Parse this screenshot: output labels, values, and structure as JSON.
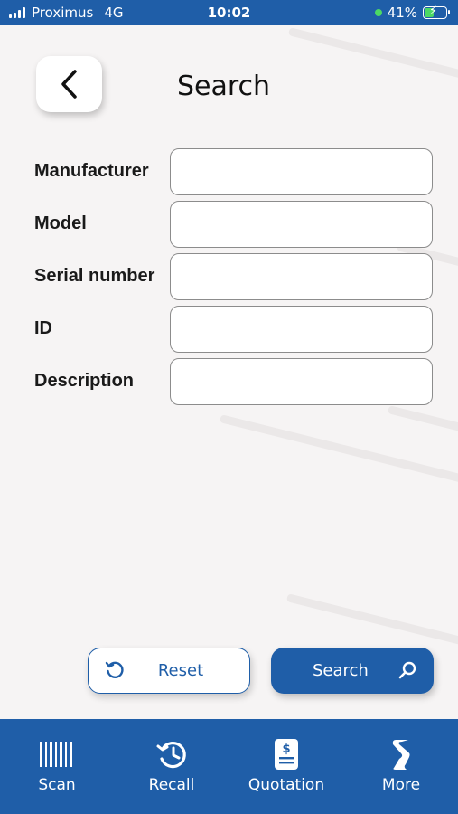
{
  "status_bar": {
    "carrier": "Proximus",
    "network": "4G",
    "time": "10:02",
    "battery": "41%",
    "battery_level": 0.41
  },
  "header": {
    "title": "Search",
    "back_icon": "chevron-left-icon"
  },
  "form": {
    "fields": [
      {
        "label": "Manufacturer",
        "value": ""
      },
      {
        "label": "Model",
        "value": ""
      },
      {
        "label": "Serial number",
        "value": ""
      },
      {
        "label": "ID",
        "value": ""
      },
      {
        "label": "Description",
        "value": ""
      }
    ]
  },
  "actions": {
    "reset_label": "Reset",
    "reset_icon": "reset-icon",
    "search_label": "Search",
    "search_icon": "search-icon"
  },
  "bottom_nav": {
    "items": [
      {
        "label": "Scan",
        "icon": "barcode-icon"
      },
      {
        "label": "Recall",
        "icon": "history-icon"
      },
      {
        "label": "Quotation",
        "icon": "quotation-icon"
      },
      {
        "label": "More",
        "icon": "more-icon"
      }
    ]
  },
  "colors": {
    "primary": "#1f5ea8",
    "background": "#f6f4f4",
    "battery_green": "#4cd964"
  }
}
